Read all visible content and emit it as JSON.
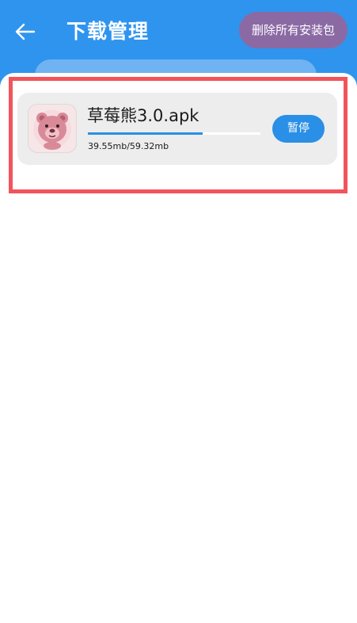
{
  "header": {
    "back_icon": "back-arrow-icon",
    "title": "下载管理",
    "delete_all_label": "删除所有安装包",
    "colors": {
      "header_bg": "#2f94ee",
      "delete_btn_bg": "#8b6aa4"
    }
  },
  "downloads": [
    {
      "app_icon": "bear-app-icon",
      "file_name": "草莓熊3.0.apk",
      "progress_fraction": 0.667,
      "size_text": "39.55mb/59.32mb",
      "action_label": "暂停",
      "colors": {
        "progress": "#2a8fe6",
        "button_bg": "#2a8fe6"
      }
    }
  ],
  "highlight_color": "#f2545b"
}
